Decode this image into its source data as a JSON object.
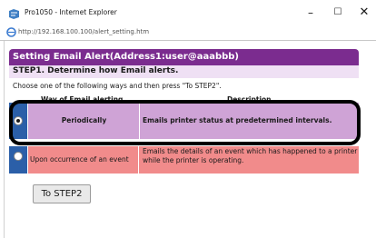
{
  "window": {
    "title": "Pro1050 - Internet Explorer",
    "minimize_glyph": "–",
    "maximize_glyph": "☐",
    "close_glyph": "✕"
  },
  "address": {
    "url": "http://192.168.100.100/alert_setting.htm"
  },
  "page": {
    "header": "Setting Email Alert(Address1:user@aaabbb)",
    "step_title": "STEP1. Determine how Email alerts.",
    "instruction": "Choose one of the following ways and then press \"To STEP2\".",
    "columns": [
      "Way of Email alerting",
      "Description"
    ],
    "options": [
      {
        "way": "Periodically",
        "description": "Emails printer status at predetermined intervals.",
        "selected": true
      },
      {
        "way": "Upon occurrence of an event",
        "description": "Emails the details of an event which has happened to a printer while the printer is operating.",
        "selected": false
      }
    ],
    "next_button": "To STEP2"
  },
  "colors": {
    "header_bg": "#7b2c8f",
    "step_bg": "#efe0f4",
    "row_periodic_bg": "#cfa3d6",
    "row_event_bg": "#f18b8b",
    "radio_column_bg": "#2b5fa8"
  }
}
